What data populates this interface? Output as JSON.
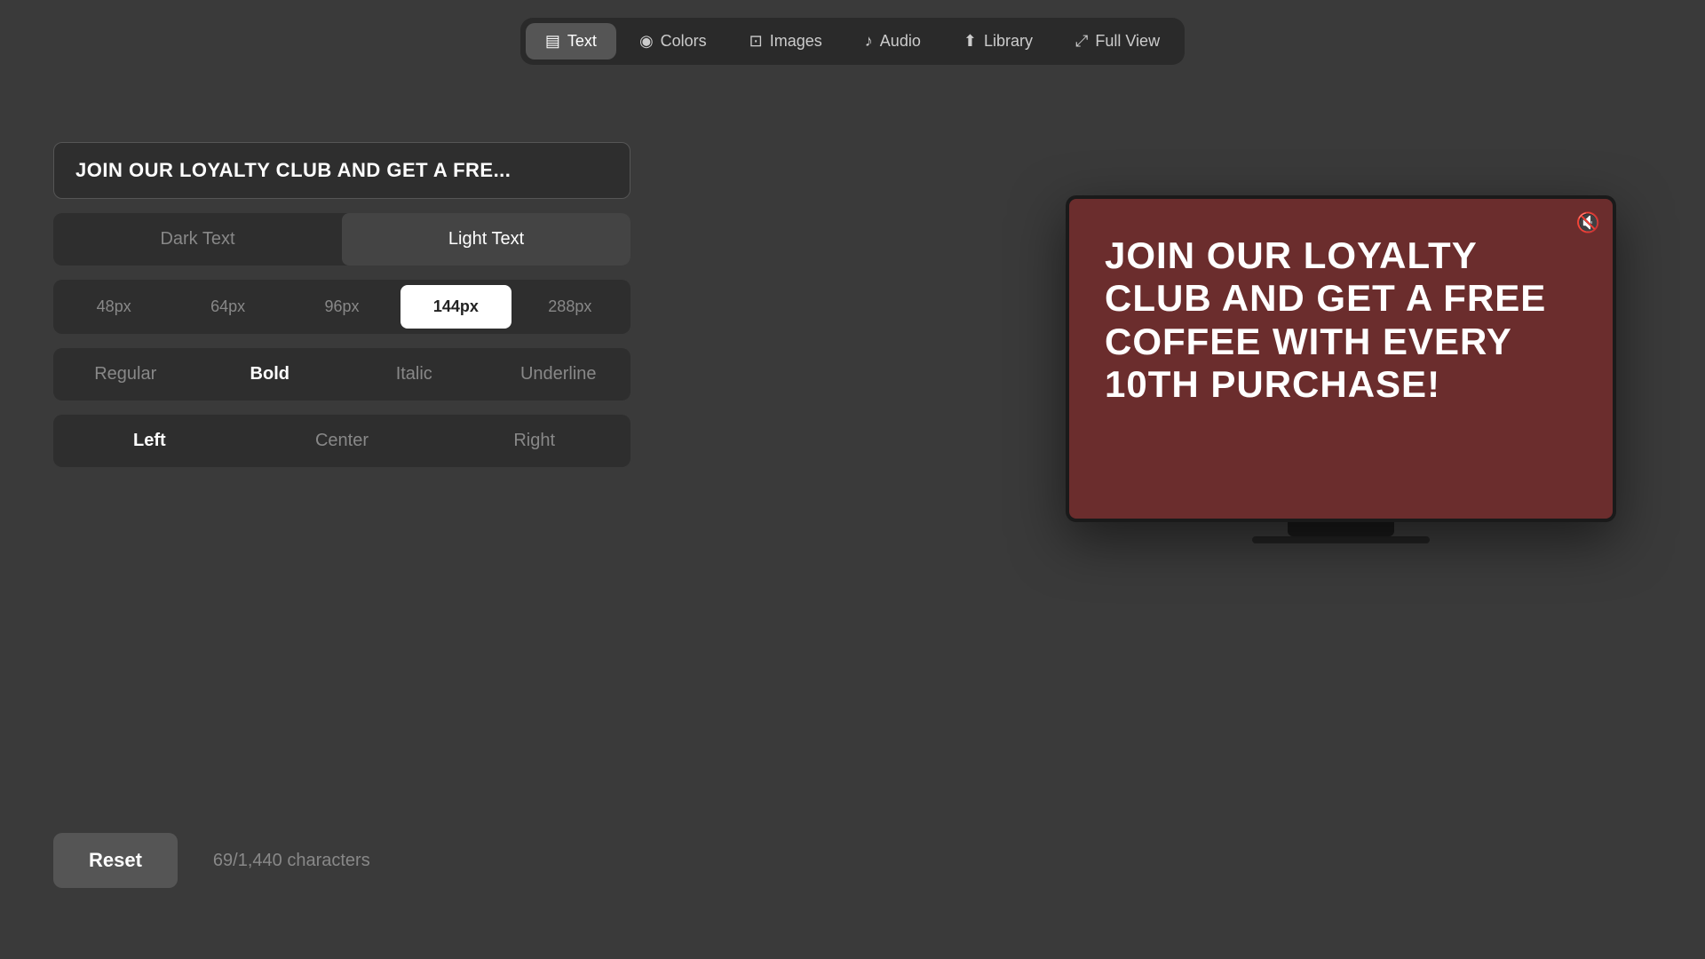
{
  "nav": {
    "items": [
      {
        "id": "text",
        "label": "Text",
        "icon": "▤",
        "active": true
      },
      {
        "id": "colors",
        "label": "Colors",
        "icon": "🎨",
        "active": false
      },
      {
        "id": "images",
        "label": "Images",
        "icon": "🖼",
        "active": false
      },
      {
        "id": "audio",
        "label": "Audio",
        "icon": "♪",
        "active": false
      },
      {
        "id": "library",
        "label": "Library",
        "icon": "⬆",
        "active": false
      },
      {
        "id": "fullview",
        "label": "Full View",
        "icon": "⤢",
        "active": false
      }
    ]
  },
  "textPanel": {
    "inputText": "JOIN OUR LOYALTY CLUB AND GET A FRE...",
    "textColorOptions": [
      {
        "id": "dark",
        "label": "Dark Text",
        "active": false
      },
      {
        "id": "light",
        "label": "Light Text",
        "active": true
      }
    ],
    "fontSizes": [
      {
        "id": "48px",
        "label": "48px",
        "active": false
      },
      {
        "id": "64px",
        "label": "64px",
        "active": false
      },
      {
        "id": "96px",
        "label": "96px",
        "active": false
      },
      {
        "id": "144px",
        "label": "144px",
        "active": true
      },
      {
        "id": "288px",
        "label": "288px",
        "active": false
      }
    ],
    "textStyles": [
      {
        "id": "regular",
        "label": "Regular",
        "active": false
      },
      {
        "id": "bold",
        "label": "Bold",
        "active": true
      },
      {
        "id": "italic",
        "label": "Italic",
        "active": false
      },
      {
        "id": "underline",
        "label": "Underline",
        "active": false
      }
    ],
    "alignments": [
      {
        "id": "left",
        "label": "Left",
        "active": true
      },
      {
        "id": "center",
        "label": "Center",
        "active": false
      },
      {
        "id": "right",
        "label": "Right",
        "active": false
      }
    ],
    "resetLabel": "Reset",
    "charCount": "69/1,440 characters"
  },
  "preview": {
    "text": "JOIN OUR LOYALTY CLUB AND GET A FREE COFFEE WITH EVERY 10TH PURCHASE!",
    "bgColor": "#6b2d2d",
    "muteIcon": "🔇"
  }
}
